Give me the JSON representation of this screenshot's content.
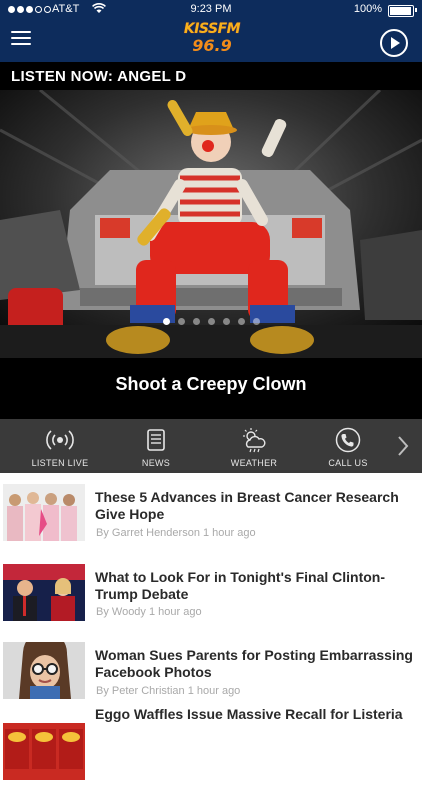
{
  "status_bar": {
    "carrier": "AT&T",
    "time": "9:23 PM",
    "battery": "100%"
  },
  "header": {
    "logo_line1": "KISSFM",
    "logo_line2": "96.9"
  },
  "hero": {
    "listen_now": "LISTEN NOW: ANGEL D",
    "slide_title": "Shoot a Creepy Clown",
    "slide_count": 7,
    "active_slide": 1
  },
  "quick_nav": {
    "items": [
      {
        "label": "LISTEN LIVE",
        "icon": "broadcast-icon"
      },
      {
        "label": "NEWS",
        "icon": "newspaper-icon"
      },
      {
        "label": "WEATHER",
        "icon": "weather-icon"
      },
      {
        "label": "CALL US",
        "icon": "phone-icon"
      }
    ]
  },
  "articles": [
    {
      "headline": "These 5 Advances in Breast Cancer Research Give Hope",
      "byline": "By Garret Henderson 1 hour ago"
    },
    {
      "headline": "What to Look For in Tonight's Final Clinton-Trump Debate",
      "byline": "By Woody 1 hour ago"
    },
    {
      "headline": "Woman Sues Parents for Posting Embarrassing Facebook Photos",
      "byline": "By Peter Christian 1 hour ago"
    },
    {
      "headline": "Eggo Waffles Issue Massive Recall for Listeria",
      "byline": ""
    }
  ],
  "colors": {
    "header_bg": "#0d2c5c",
    "nav_bg": "#3a3a3a",
    "logo_orange": "#f28c1a"
  }
}
